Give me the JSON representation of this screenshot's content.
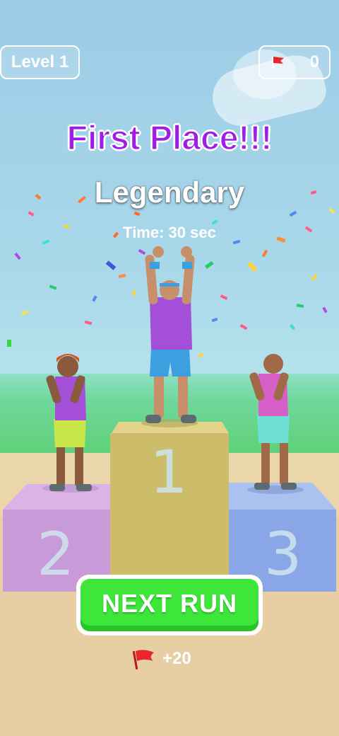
{
  "hud": {
    "level_label": "Level 1",
    "flag_count": "0",
    "flag_icon": "red-flag-icon"
  },
  "result": {
    "title": "First Place!!!",
    "rating": "Legendary",
    "time": "Time:  30 sec"
  },
  "podium": {
    "first": "1",
    "second": "2",
    "third": "3"
  },
  "actions": {
    "next_label": "NEXT RUN",
    "reward": "+20",
    "reward_icon": "red-flag-icon"
  },
  "colors": {
    "title": "#a21ce8",
    "button": "#3ee63a",
    "podium_first": "#cdbd6b",
    "podium_second": "#c79ad8",
    "podium_third": "#8aa6e6",
    "flag": "#e8262b"
  }
}
